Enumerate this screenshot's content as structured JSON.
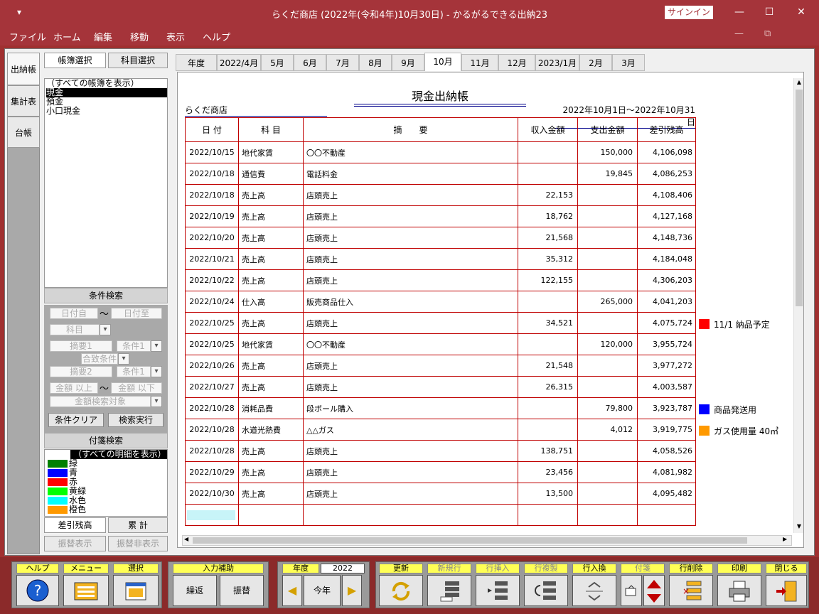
{
  "window": {
    "title": "らくだ商店 (2022年(令和4年)10月30日)  -  かるがるできる出納23",
    "signin": "サインイン",
    "quick_access": "▾",
    "minimize": "—",
    "maximize": "☐",
    "close": "✕",
    "ribbon_min": "—",
    "ribbon_restore": "⧉"
  },
  "menu": [
    "ファイル",
    "ホーム",
    "編集",
    "移動",
    "表示",
    "ヘルプ"
  ],
  "left_tabs": [
    "出納帳",
    "集計表",
    "台帳"
  ],
  "sub_tabs": [
    "帳簿選択",
    "科目選択"
  ],
  "books": [
    "（すべての帳簿を表示）",
    "現金",
    "預金",
    "小口現金"
  ],
  "search": {
    "header": "条件検索",
    "date_from": "日付自",
    "date_to": "日付至",
    "tilde": "〜",
    "subject": "科目",
    "memo1": "摘要1",
    "cond1": "条件1",
    "match": "合致条件",
    "memo2": "摘要2",
    "cond2": "条件1",
    "amount_min": "金額 以上",
    "amount_max": "金額 以下",
    "amount_target": "金額検索対象",
    "clear": "条件クリア",
    "exec": "検索実行"
  },
  "tags": {
    "header": "付箋検索",
    "all": "（すべての明細を表示）",
    "items": [
      {
        "label": "緑",
        "color": "#008000"
      },
      {
        "label": "青",
        "color": "#0000ff"
      },
      {
        "label": "赤",
        "color": "#ff0000"
      },
      {
        "label": "黄緑",
        "color": "#00ff00"
      },
      {
        "label": "水色",
        "color": "#00ffff"
      },
      {
        "label": "橙色",
        "color": "#ff9900"
      }
    ]
  },
  "balance_tabs": [
    "差引残高",
    "累 計"
  ],
  "transfer_tabs": [
    "振替表示",
    "振替非表示"
  ],
  "months": [
    "年度",
    "2022/4月",
    "5月",
    "6月",
    "7月",
    "8月",
    "9月",
    "10月",
    "11月",
    "12月",
    "2023/1月",
    "2月",
    "3月"
  ],
  "active_month": "10月",
  "doc": {
    "title": "現金出納帳",
    "company": "らくだ商店",
    "period": "2022年10月1日～2022年10月31日",
    "headers": [
      "日 付",
      "科 目",
      "摘　　要",
      "収入金額",
      "支出金額",
      "差引残高"
    ],
    "rows": [
      [
        "2022/10/15",
        "地代家賃",
        "〇〇不動産",
        "",
        "150,000",
        "4,106,098"
      ],
      [
        "2022/10/18",
        "通信費",
        "電話料金",
        "",
        "19,845",
        "4,086,253"
      ],
      [
        "2022/10/18",
        "売上高",
        "店頭売上",
        "22,153",
        "",
        "4,108,406"
      ],
      [
        "2022/10/19",
        "売上高",
        "店頭売上",
        "18,762",
        "",
        "4,127,168"
      ],
      [
        "2022/10/20",
        "売上高",
        "店頭売上",
        "21,568",
        "",
        "4,148,736"
      ],
      [
        "2022/10/21",
        "売上高",
        "店頭売上",
        "35,312",
        "",
        "4,184,048"
      ],
      [
        "2022/10/22",
        "売上高",
        "店頭売上",
        "122,155",
        "",
        "4,306,203"
      ],
      [
        "2022/10/24",
        "仕入高",
        "販売商品仕入",
        "",
        "265,000",
        "4,041,203"
      ],
      [
        "2022/10/25",
        "売上高",
        "店頭売上",
        "34,521",
        "",
        "4,075,724"
      ],
      [
        "2022/10/25",
        "地代家賃",
        "〇〇不動産",
        "",
        "120,000",
        "3,955,724"
      ],
      [
        "2022/10/26",
        "売上高",
        "店頭売上",
        "21,548",
        "",
        "3,977,272"
      ],
      [
        "2022/10/27",
        "売上高",
        "店頭売上",
        "26,315",
        "",
        "4,003,587"
      ],
      [
        "2022/10/28",
        "消耗品費",
        "段ボール購入",
        "",
        "79,800",
        "3,923,787"
      ],
      [
        "2022/10/28",
        "水道光熱費",
        "△△ガス",
        "",
        "4,012",
        "3,919,775"
      ],
      [
        "2022/10/28",
        "売上高",
        "店頭売上",
        "138,751",
        "",
        "4,058,526"
      ],
      [
        "2022/10/29",
        "売上高",
        "店頭売上",
        "23,456",
        "",
        "4,081,982"
      ],
      [
        "2022/10/30",
        "売上高",
        "店頭売上",
        "13,500",
        "",
        "4,095,482"
      ]
    ],
    "notes": [
      {
        "row": 8,
        "color": "#ff0000",
        "text": "11/1 納品予定"
      },
      {
        "row": 12,
        "color": "#0000ff",
        "text": "商品発送用"
      },
      {
        "row": 13,
        "color": "#ff9900",
        "text": "ガス使用量 40㎥"
      }
    ]
  },
  "toolbar": {
    "help": "ヘルプ",
    "menu": "メニュー",
    "select": "選択",
    "input_assist": "入力補助",
    "repeat": "繰返",
    "transfer": "振替",
    "year_label": "年度",
    "year": "2022",
    "this_year": "今年",
    "update": "更新",
    "new_row": "新規行",
    "insert_row": "行挿入",
    "copy_row": "行複製",
    "swap_row": "行入換",
    "tag": "付箋",
    "delete_row": "行削除",
    "print": "印刷",
    "close": "閉じる"
  },
  "colors": {
    "accent": "#a5343a",
    "grid": "#c00000"
  }
}
